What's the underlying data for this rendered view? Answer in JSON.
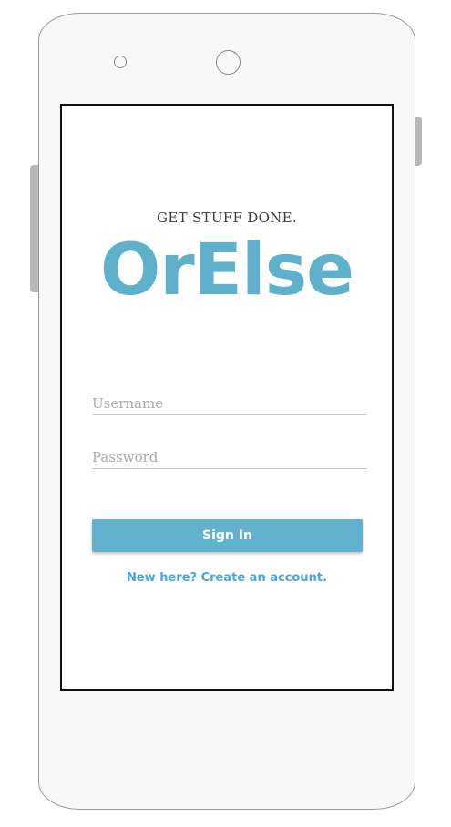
{
  "app": {
    "tagline": "GET STUFF DONE.",
    "logo_text": "OrElse"
  },
  "form": {
    "username_placeholder": "Username",
    "username_value": "",
    "password_placeholder": "Password",
    "password_value": "",
    "signin_label": "Sign In",
    "create_account_link": "New here? Create an account."
  },
  "colors": {
    "brand": "#5fb0cb",
    "button": "#62b1cd",
    "link": "#4aa6e0"
  },
  "icons": {
    "front_camera": "camera-icon",
    "proximity_sensor": "sensor-icon"
  }
}
